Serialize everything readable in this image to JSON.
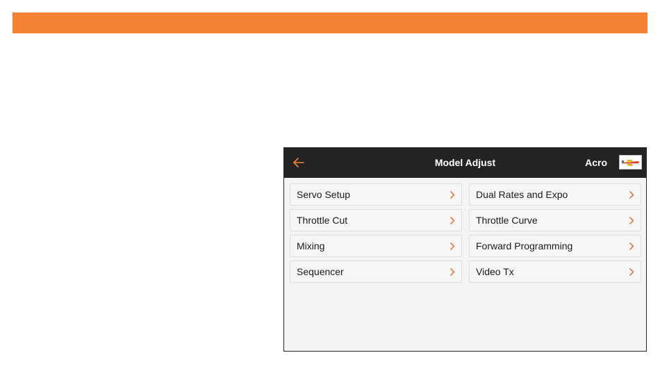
{
  "screen": {
    "title": "Model Adjust",
    "model_name": "Acro",
    "back_icon": "back-arrow-icon",
    "model_icon": "airplane-thumbnail-icon",
    "accent_color": "#f58233",
    "header_color": "#232323"
  },
  "menu": {
    "left": [
      {
        "label": "Servo Setup"
      },
      {
        "label": "Throttle Cut"
      },
      {
        "label": "Mixing"
      },
      {
        "label": "Sequencer"
      }
    ],
    "right": [
      {
        "label": "Dual Rates and Expo"
      },
      {
        "label": "Throttle Curve"
      },
      {
        "label": "Forward Programming"
      },
      {
        "label": "Video Tx"
      }
    ]
  }
}
